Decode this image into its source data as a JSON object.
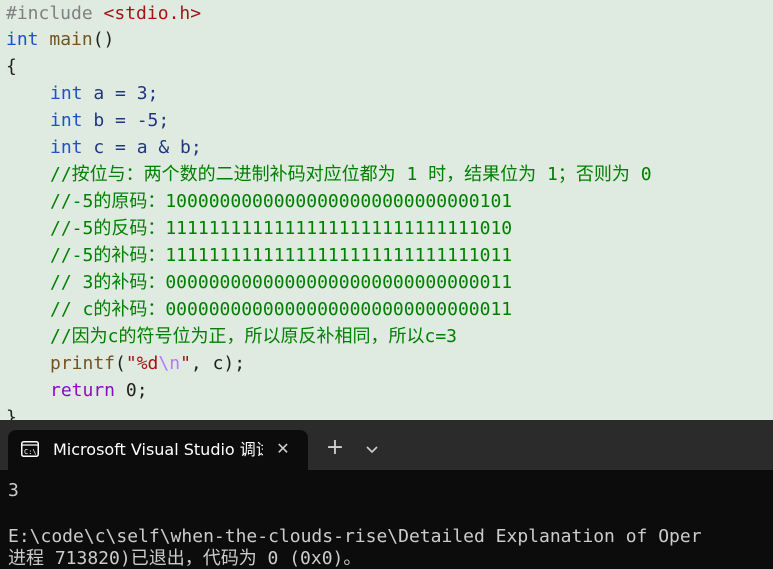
{
  "editor": {
    "include": {
      "directive": "#include",
      "header": "<stdio.h>"
    },
    "main_sig": {
      "type": "int",
      "name": "main",
      "parens": "()"
    },
    "open_brace": "{",
    "close_brace": "}",
    "decl_a": {
      "type": "int",
      "rest": " a = 3;"
    },
    "decl_b": {
      "type": "int",
      "rest": " b = -5;"
    },
    "decl_c": {
      "type": "int",
      "rest": " c = a & b;"
    },
    "comments": [
      "//按位与：两个数的二进制补码对应位都为 1 时，结果位为 1；否则为 0",
      "//-5的原码：10000000000000000000000000000101",
      "//-5的反码：11111111111111111111111111111010",
      "//-5的补码：11111111111111111111111111111011",
      "// 3的补码：00000000000000000000000000000011",
      "// c的补码：00000000000000000000000000000011",
      "//因为c的符号位为正，所以原反补相同，所以c=3"
    ],
    "printf_stmt": {
      "fn": "printf",
      "open": "(",
      "str_open": "\"%d",
      "escape": "\\n",
      "str_close": "\"",
      "args": ", c);"
    },
    "return_stmt": {
      "keyword": "return",
      "rest": " 0;"
    }
  },
  "terminal": {
    "tab_title": "Microsoft Visual Studio 调试",
    "close_glyph": "✕",
    "new_tab_glyph": "+",
    "output": "3",
    "path_line": "E:\\code\\c\\self\\when-the-clouds-rise\\Detailed Explanation of Oper",
    "exit_line": "进程 713820)已退出，代码为 0 (0x0)。"
  }
}
